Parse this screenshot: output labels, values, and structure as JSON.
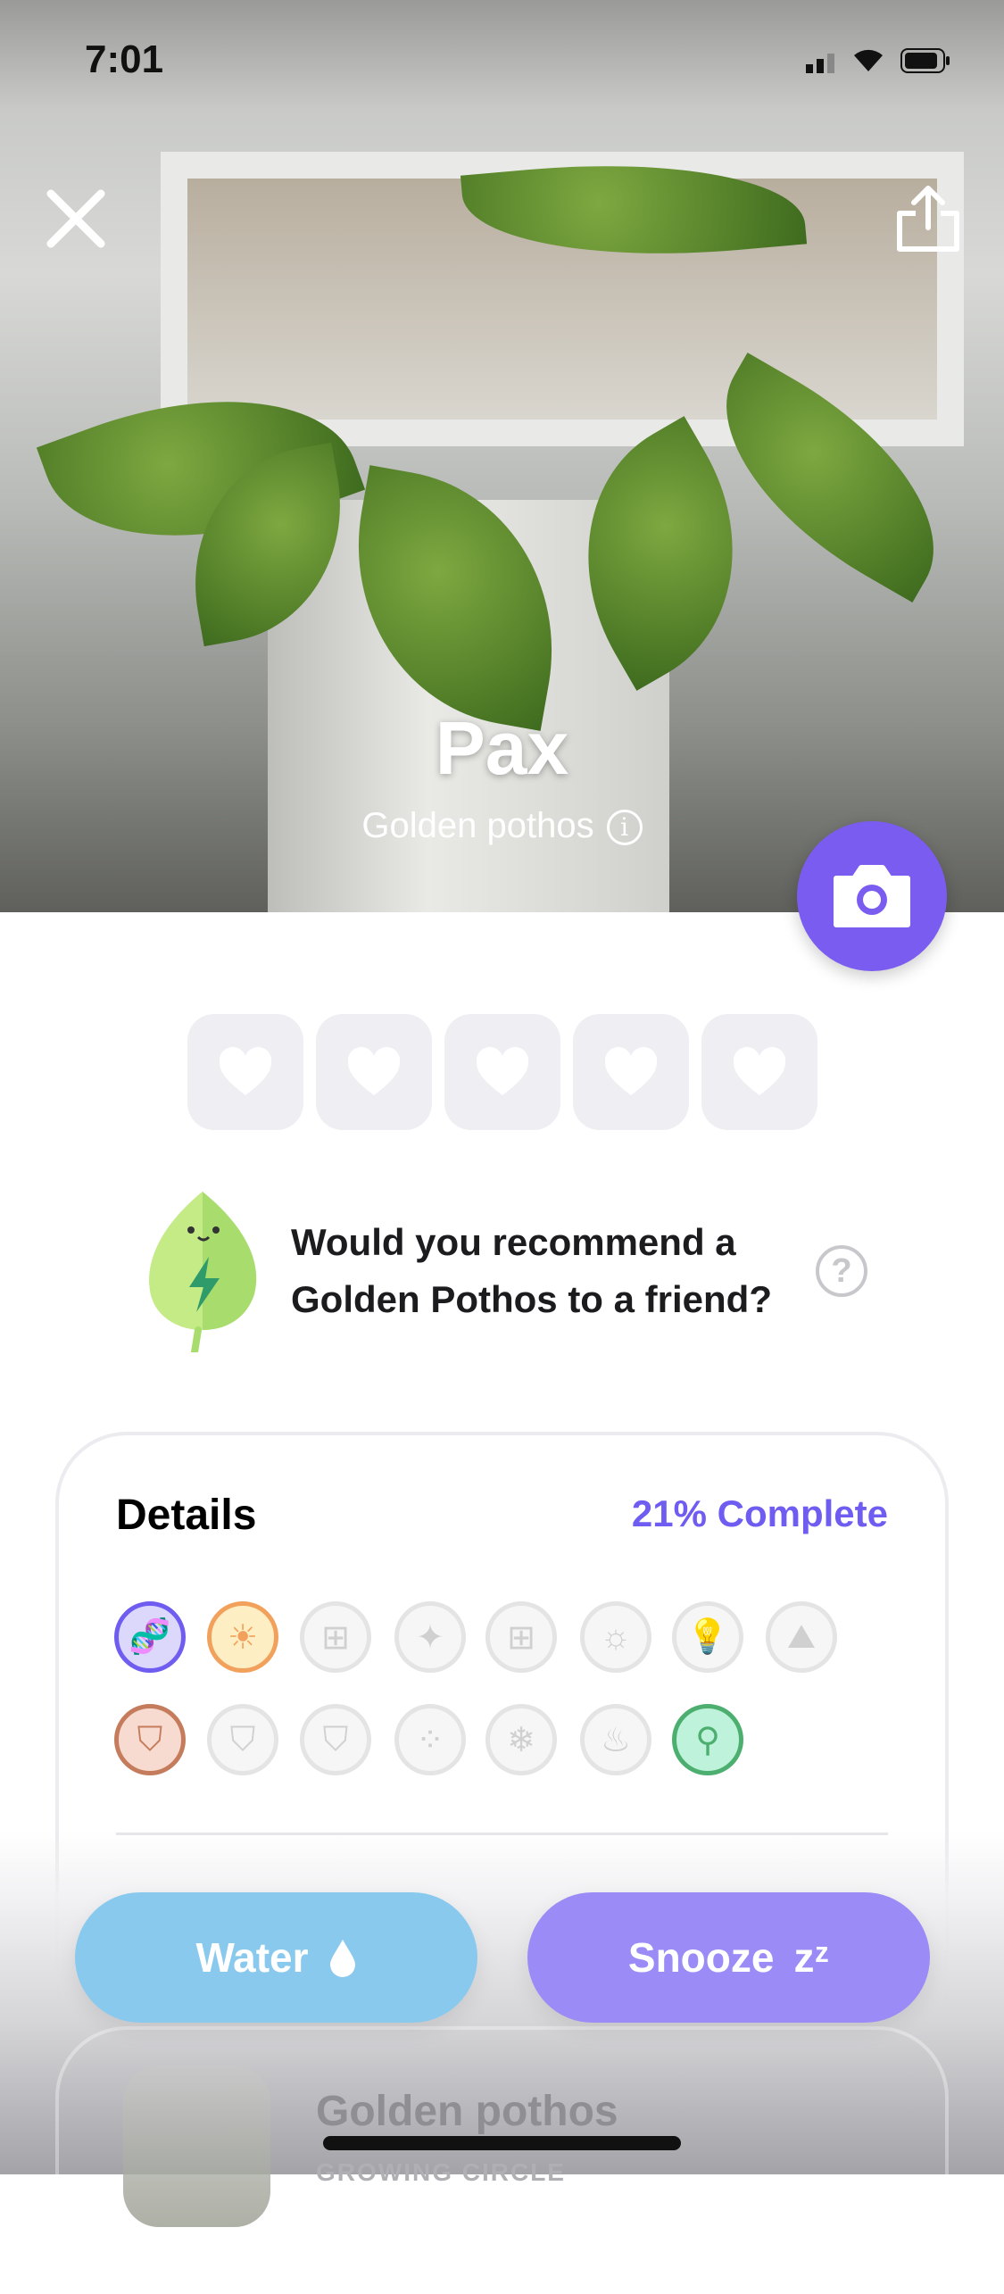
{
  "status_bar": {
    "time": "7:01"
  },
  "plant": {
    "name": "Pax",
    "species": "Golden pothos"
  },
  "icons": {
    "close": "close-icon",
    "share": "share-icon",
    "camera": "camera-icon",
    "info": "info-icon"
  },
  "rating": {
    "hearts": 5,
    "filled": 0
  },
  "prompt": {
    "line1": "Would you recommend a",
    "line2": "Golden Pothos to a friend?",
    "help": "?"
  },
  "details": {
    "title": "Details",
    "progress_label": "21% Complete",
    "progress": 21,
    "accent": "#6f5cf0",
    "items": [
      {
        "icon": "dna-icon",
        "active": true,
        "color": "#6f5cf0",
        "bg": "#dcd8fb"
      },
      {
        "icon": "sun-icon",
        "active": true,
        "color": "#f2a15c",
        "bg": "#fdeec3"
      },
      {
        "icon": "window-icon",
        "active": false
      },
      {
        "icon": "compass-icon",
        "active": false
      },
      {
        "icon": "window-frame-icon",
        "active": false
      },
      {
        "icon": "sun-clock-icon",
        "active": false
      },
      {
        "icon": "lightbulb-icon",
        "active": false
      },
      {
        "icon": "sunrise-icon",
        "active": false
      },
      {
        "icon": "pot-icon",
        "active": true,
        "color": "#c47c5c",
        "bg": "#f7dbd0"
      },
      {
        "icon": "pots-icon",
        "active": false
      },
      {
        "icon": "drainage-pot-icon",
        "active": false
      },
      {
        "icon": "soil-icon",
        "active": false
      },
      {
        "icon": "snowflake-icon",
        "active": false
      },
      {
        "icon": "flame-icon",
        "active": false
      },
      {
        "icon": "location-pin-icon",
        "active": true,
        "color": "#4caf70",
        "bg": "#bff2da"
      }
    ]
  },
  "actions": {
    "water": "Water",
    "snooze": "Snooze",
    "snooze_glyph": "zᶻ",
    "water_color": "#8ac9ee",
    "snooze_color": "#9b8bf6"
  },
  "behind": {
    "title": "Golden pothos",
    "subtitle": "GROWING CIRCLE"
  }
}
